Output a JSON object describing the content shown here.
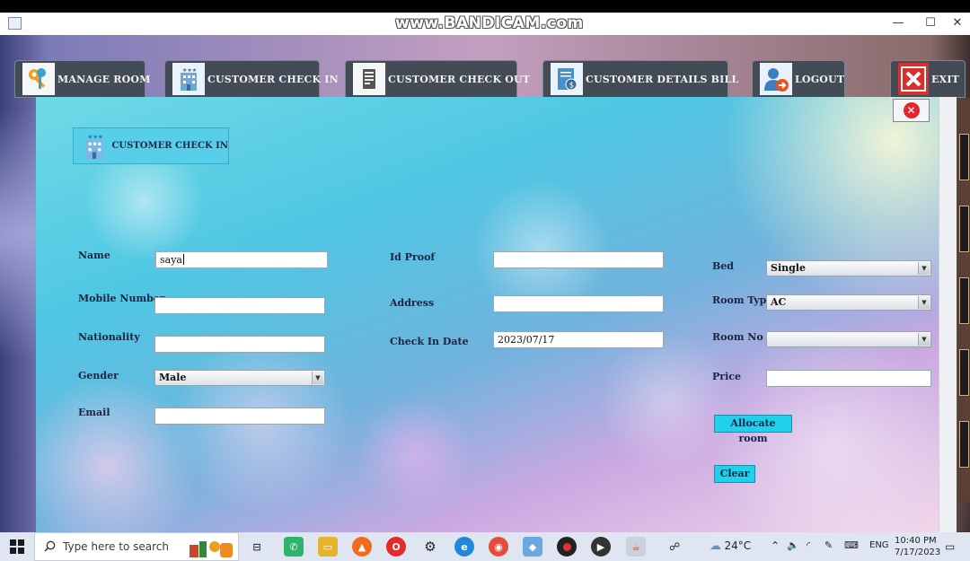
{
  "window": {
    "watermark": "www.BANDICAM.com",
    "minimize": "—",
    "maximize": "☐",
    "close": "✕"
  },
  "nav": {
    "manage_room": "MANAGE ROOM",
    "customer_check_in": "CUSTOMER CHECK IN",
    "customer_check_out": "CUSTOMER CHECK OUT",
    "customer_details_bill": "CUSTOMER DETAILS BILL",
    "logout": "LOGOUT",
    "exit": "EXIT"
  },
  "page": {
    "heading": "CUSTOMER CHECK IN"
  },
  "form": {
    "name_label": "Name",
    "name_value": "saya",
    "mobile_label": "Mobile Number",
    "mobile_value": "",
    "nationality_label": "Nationality",
    "nationality_value": "",
    "gender_label": "Gender",
    "gender_value": "Male",
    "email_label": "Email",
    "email_value": "",
    "idproof_label": "Id Proof",
    "idproof_value": "",
    "address_label": "Address",
    "address_value": "",
    "checkin_label": "Check In Date",
    "checkin_value": "2023/07/17",
    "bed_label": "Bed",
    "bed_value": "Single",
    "roomtype_label": "Room Type",
    "roomtype_value": "AC",
    "roomno_label": "Room No",
    "roomno_value": "",
    "price_label": "Price",
    "price_value": "",
    "allocate_label": "Allocate room",
    "clear_label": "Clear"
  },
  "taskbar": {
    "search_placeholder": "Type here to search",
    "weather": "24°C",
    "language": "ENG",
    "time": "10:40 PM",
    "date": "7/17/2023"
  },
  "colors": {
    "nav_bg": "#434b57",
    "action_button": "#1fd1ea",
    "close_red": "#e0292c"
  }
}
